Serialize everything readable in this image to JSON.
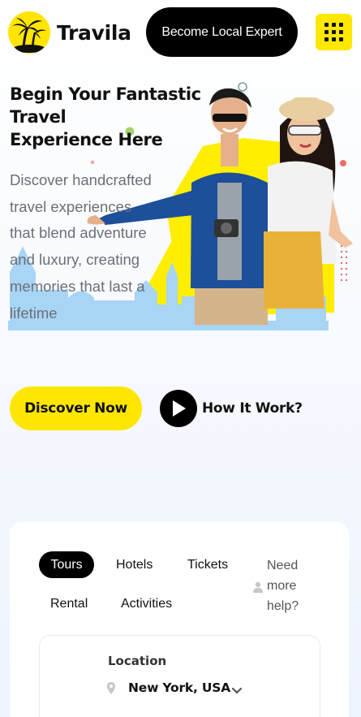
{
  "header": {
    "brand": "Travila",
    "expert_button": "Become Local Expert",
    "menu_icon": "grid-menu-icon"
  },
  "hero": {
    "headline_part1": "Begin Your ",
    "headline_bold1": "Fantastic Travel",
    "headline_bold2": "Experience",
    "headline_part2": " Here",
    "description": "Discover handcrafted travel experiences that blend adventure and luxury, creating memories that last a lifetime",
    "discover_button": "Discover Now",
    "how_it_work": "How It Work?"
  },
  "search": {
    "tabs": [
      {
        "label": "Tours",
        "active": true
      },
      {
        "label": "Hotels",
        "active": false
      },
      {
        "label": "Tickets",
        "active": false
      },
      {
        "label": "Rental",
        "active": false
      },
      {
        "label": "Activities",
        "active": false
      }
    ],
    "help_lines": [
      "Need",
      "more",
      "help?"
    ],
    "location_label": "Location",
    "location_value": "New York, USA"
  },
  "colors": {
    "accent": "#ffe600",
    "dark": "#000000",
    "skyline": "#a8d4f5"
  }
}
